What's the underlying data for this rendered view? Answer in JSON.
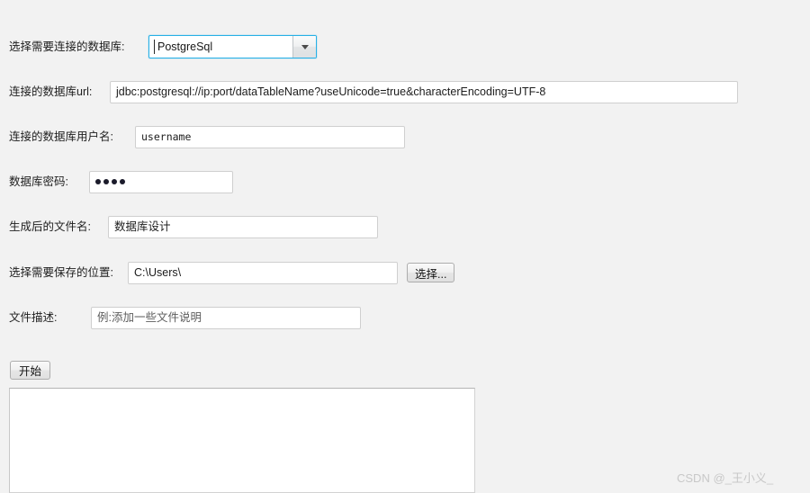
{
  "window": {
    "background_color": "#f2f2f2"
  },
  "form": {
    "rows": [
      {
        "label": "选择需要连接的数据库:",
        "type": "combobox",
        "value": "PostgreSql"
      },
      {
        "label": "连接的数据库url:",
        "type": "text",
        "value": "jdbc:postgresql://ip:port/dataTableName?useUnicode=true&characterEncoding=UTF-8"
      },
      {
        "label": "连接的数据库用户名:",
        "type": "text",
        "value": "username"
      },
      {
        "label": "数据库密码:",
        "type": "password",
        "value": "••••",
        "dot_count": 4
      },
      {
        "label": "生成后的文件名:",
        "type": "text",
        "value": "数据库设计"
      },
      {
        "label": "选择需要保存的位置:",
        "type": "text",
        "value": "C:\\Users\\",
        "button_label": "选择..."
      },
      {
        "label": "文件描述:",
        "type": "text",
        "value": "例:添加一些文件说明"
      }
    ],
    "start_button_label": "开始"
  },
  "log": {
    "value": "",
    "placeholder": ""
  },
  "watermark": {
    "text": "CSDN @_王小义_",
    "color": "#c8c8c8"
  },
  "icons": {
    "dropdown": "chevron-down-icon"
  },
  "colors": {
    "accent": "#27b0e6",
    "background": "#f2f2f2",
    "field_border": "#cfcfcf",
    "button_border": "#adadad",
    "text": "#1a1a1a"
  }
}
